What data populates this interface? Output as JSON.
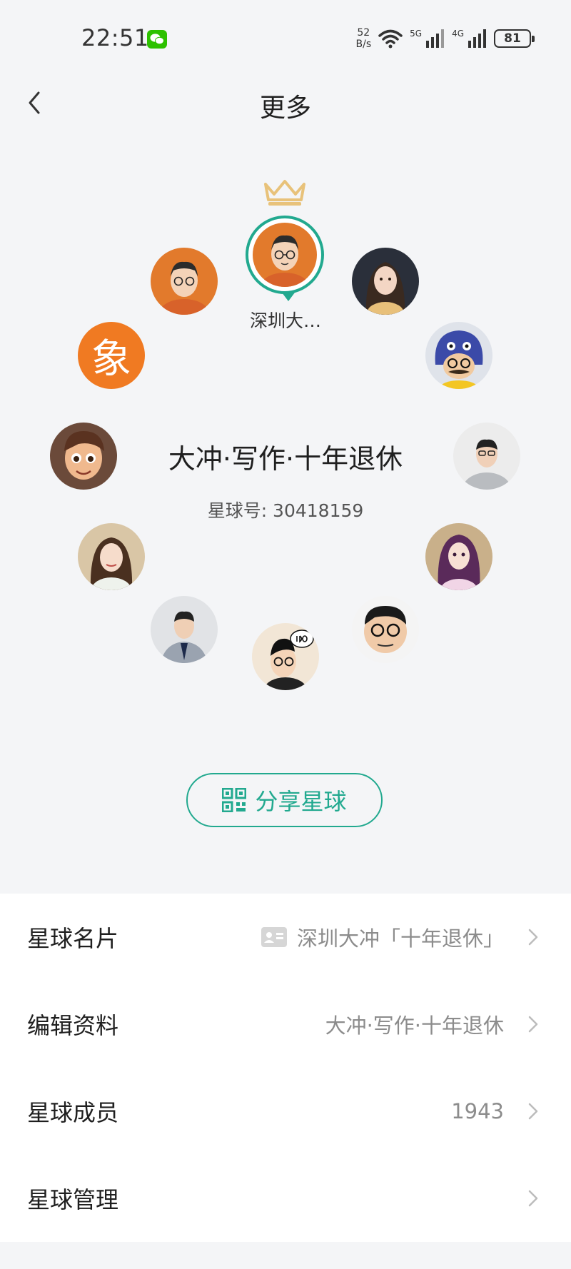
{
  "status_bar": {
    "time": "22:51",
    "net_speed_value": "52",
    "net_speed_unit": "B/s",
    "signal1_label": "5G",
    "signal2_label": "4G",
    "battery": "81"
  },
  "nav": {
    "title": "更多"
  },
  "planet": {
    "owner_name": "深圳大…",
    "name": "大冲·写作·十年退休",
    "id_label": "星球号: 30418159",
    "avatar_badge_char": "象"
  },
  "share_button": {
    "label": "分享星球"
  },
  "menu": [
    {
      "label": "星球名片",
      "value": "深圳大冲「十年退休」"
    },
    {
      "label": "编辑资料",
      "value": "大冲·写作·十年退休"
    },
    {
      "label": "星球成员",
      "value": "1943"
    },
    {
      "label": "星球管理",
      "value": ""
    }
  ],
  "colors": {
    "accent": "#22a98f",
    "crown": "#e8c27a",
    "background": "#f4f5f7",
    "badge_orange": "#f07a22"
  },
  "icons": [
    "wechat-icon",
    "wifi-icon",
    "signal-icon",
    "battery-icon",
    "back-icon",
    "crown-icon",
    "qr-code-icon",
    "card-icon",
    "chevron-right-icon"
  ]
}
